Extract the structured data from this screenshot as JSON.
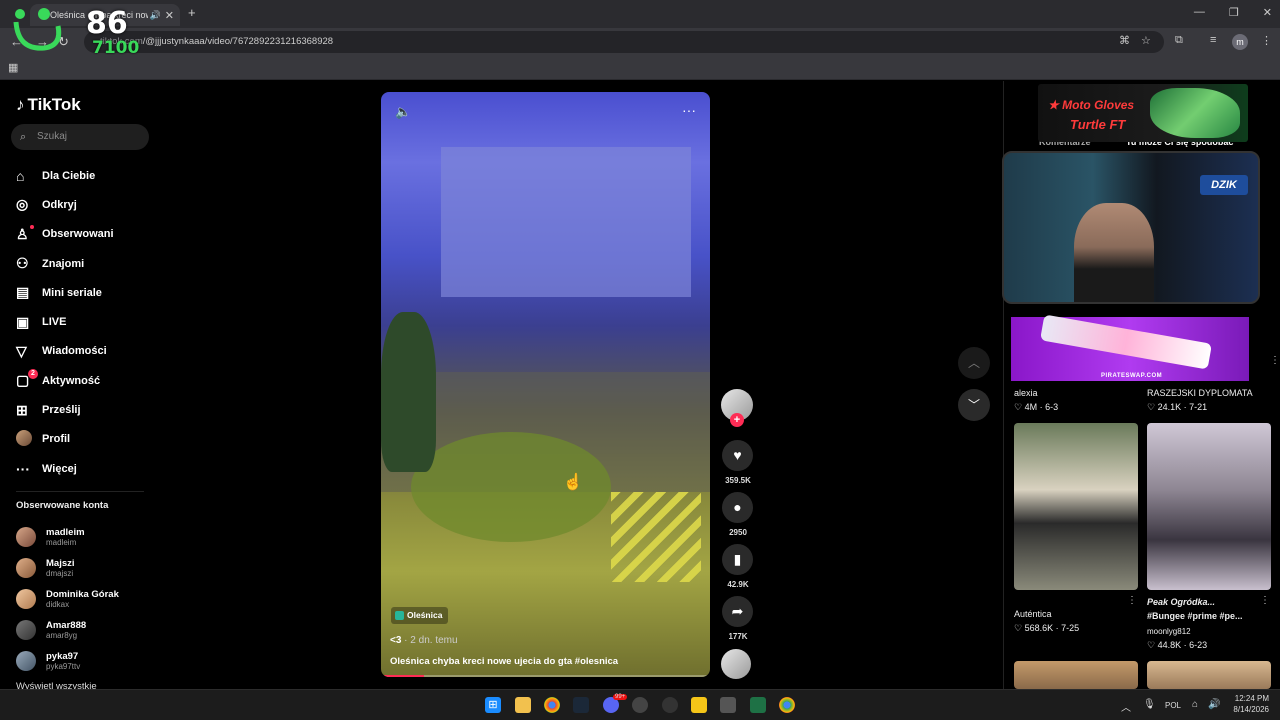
{
  "browser": {
    "tab_title": "Oleśnica chyba kreci nowe...",
    "url_domain": "tiktok.com",
    "url_path": "/@jjjustynkaaa/video/7672892231216368928",
    "profile_initial": "m"
  },
  "overlay": {
    "score_big": "86",
    "score_small": "7100"
  },
  "tiktok": {
    "logo": "TikTok",
    "search_placeholder": "Szukaj",
    "nav": [
      {
        "label": "Dla Ciebie"
      },
      {
        "label": "Odkryj"
      },
      {
        "label": "Obserwowani"
      },
      {
        "label": "Znajomi"
      },
      {
        "label": "Mini seriale"
      },
      {
        "label": "LIVE"
      },
      {
        "label": "Wiadomości"
      },
      {
        "label": "Aktywność",
        "badge": "2"
      },
      {
        "label": "Prześlij"
      },
      {
        "label": "Profil"
      },
      {
        "label": "Więcej"
      }
    ],
    "following_header": "Obserwowane konta",
    "following": [
      {
        "name": "madleim",
        "user": "madleim"
      },
      {
        "name": "Majszi",
        "user": "dmajszi"
      },
      {
        "name": "Dominika Górak",
        "user": "didkax"
      },
      {
        "name": "Amar888",
        "user": "amar8yg"
      },
      {
        "name": "pyka97",
        "user": "pyka97ttv"
      }
    ],
    "show_all": "Wyświetl wszystkie"
  },
  "video": {
    "location": "Oleśnica",
    "author": "<3",
    "time": " · 2 dn. temu",
    "description": "Oleśnica chyba kreci nowe ujecia do gta #olesnica",
    "progress": 0.13,
    "likes": "359.5K",
    "comments": "2950",
    "saves": "42.9K",
    "shares": "177K"
  },
  "right_panel": {
    "tab_comments": "Komentarze",
    "tab_liked": "Tu może Ci się spodobać",
    "items": [
      {
        "title": "alexia",
        "likes": "4M",
        "date": "6-3"
      },
      {
        "title": "RASZEJSKI DYPLOMATA",
        "likes": "24.1K",
        "date": "7-21"
      },
      {
        "title": "Auténtica",
        "likes": "568.6K",
        "date": "7-25"
      },
      {
        "title": "Peak Ogródka...",
        "subtitle": "#Bungee #prime #pe...",
        "author": "moonlyg812",
        "likes": "44.8K",
        "date": "6-23"
      }
    ]
  },
  "stream_overlays": {
    "ad_line1": "★ Moto Gloves",
    "ad_line2": "Turtle FT",
    "cam_logo": "DZIK",
    "pirate_text": "PIRATESWAP.COM"
  },
  "taskbar": {
    "lang": "POL",
    "time": "12:24 PM",
    "date": "8/14/2026",
    "discord_badge": "99+"
  }
}
